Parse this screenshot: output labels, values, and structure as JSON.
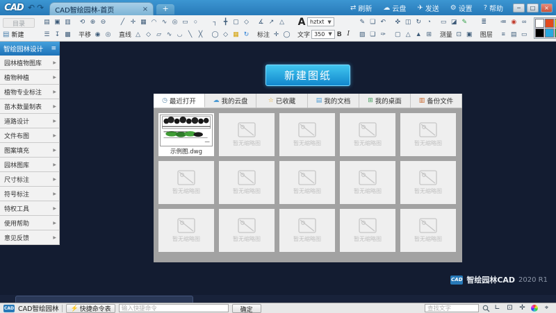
{
  "titlebar": {
    "logo": "CAD",
    "back_icon": "↶",
    "forward_icon": "↷",
    "tab_title": "CAD智绘园林-首页",
    "tab_close": "×",
    "new_tab": "+",
    "actions": [
      {
        "n": "refresh-icon",
        "g": "⇄",
        "label": "刷新"
      },
      {
        "n": "cloud-icon",
        "g": "☁",
        "label": "云盘"
      },
      {
        "n": "send-icon",
        "g": "✈",
        "label": "发送"
      },
      {
        "n": "settings-icon",
        "g": "⚙",
        "label": "设置"
      },
      {
        "n": "help-icon",
        "g": "?",
        "label": "帮助"
      }
    ],
    "window_controls": [
      {
        "n": "minimize-icon",
        "g": "─"
      },
      {
        "n": "maximize-icon",
        "g": "□"
      },
      {
        "n": "close-icon",
        "g": "×",
        "close": "close"
      }
    ]
  },
  "toolbar": {
    "catalog": "目录",
    "new": "新建",
    "new_icon": "▤",
    "pan_label": "平移",
    "line_label": "直线",
    "dim_label": "标注",
    "text_big": "A",
    "text_label": "文字",
    "font": "hztxt",
    "size": "350",
    "bold": "B",
    "italic": "I",
    "measure_label": "测量",
    "layer_label": "图层",
    "g2r1": [
      {
        "n": "open-icon",
        "g": "▤"
      },
      {
        "n": "save-icon",
        "g": "▣"
      },
      {
        "n": "save-as-icon",
        "g": "▥"
      }
    ],
    "g2r2": [
      {
        "n": "print-icon",
        "g": "☰"
      },
      {
        "n": "export-icon",
        "g": "↧"
      },
      {
        "n": "image-export-icon",
        "g": "▩"
      }
    ],
    "g3r1": [
      {
        "n": "orbit-icon",
        "g": "⟲"
      },
      {
        "n": "zoom-in-icon",
        "g": "⊕"
      },
      {
        "n": "zoom-out-icon",
        "g": "⊖"
      }
    ],
    "g3r2": [
      {
        "n": "zoom-realtime-icon",
        "g": "◉"
      },
      {
        "n": "zoom-extents-icon",
        "g": "◎"
      }
    ],
    "g4r1": [
      {
        "n": "line-icon",
        "g": "╱"
      },
      {
        "n": "point-icon",
        "g": "✛"
      },
      {
        "n": "array-icon",
        "g": "▦"
      },
      {
        "n": "arc-icon",
        "g": "◠"
      },
      {
        "n": "spline-icon",
        "g": "∿"
      },
      {
        "n": "circle-icon",
        "g": "◎"
      },
      {
        "n": "rectangle-icon",
        "g": "▭"
      },
      {
        "n": "ellipse-icon",
        "g": "○"
      }
    ],
    "g4r2": [
      {
        "n": "triangle-icon",
        "g": "△"
      },
      {
        "n": "polygon-icon",
        "g": "◇"
      },
      {
        "n": "parallelogram-icon",
        "g": "▱"
      },
      {
        "n": "wave-icon",
        "g": "∿"
      },
      {
        "n": "halfcircle-icon",
        "g": "◡"
      },
      {
        "n": "segment-icon",
        "g": "╲"
      },
      {
        "n": "crossline-icon",
        "g": "╳"
      }
    ],
    "g5r1": [
      {
        "n": "chamfer-icon",
        "g": "┐"
      },
      {
        "n": "extend-icon",
        "g": "╋"
      },
      {
        "n": "round-rect-icon",
        "g": "▢"
      },
      {
        "n": "poly2-icon",
        "g": "◇"
      }
    ],
    "g5r2": [
      {
        "n": "circle2-icon",
        "g": "◯"
      },
      {
        "n": "hexagon-icon",
        "g": "◇"
      },
      {
        "n": "grid-icon",
        "g": "▦",
        "css": "color:#d4a106"
      },
      {
        "n": "sync-icon",
        "g": "↻",
        "css": "color:#2a7fd4"
      }
    ],
    "g6r1": [
      {
        "n": "angular-dim-icon",
        "g": "∡"
      },
      {
        "n": "leader-icon",
        "g": "↗"
      },
      {
        "n": "tolerance-icon",
        "g": "△"
      }
    ],
    "g6r2": [
      {
        "n": "center-mark-icon",
        "g": "✛"
      },
      {
        "n": "diameter-dim-icon",
        "g": "◯"
      }
    ],
    "g8r1": [
      {
        "n": "sketch-icon",
        "g": "✎"
      },
      {
        "n": "copy-icon",
        "g": "❏"
      },
      {
        "n": "undo-icon",
        "g": "↶"
      }
    ],
    "g8r2": [
      {
        "n": "erase-icon",
        "g": "▨"
      },
      {
        "n": "paste-icon",
        "g": "❏"
      },
      {
        "n": "brush-icon",
        "g": "✑"
      }
    ],
    "g9r1": [
      {
        "n": "move-icon",
        "g": "✜"
      },
      {
        "n": "window-icon",
        "g": "◫"
      },
      {
        "n": "rotate-icon",
        "g": "↻"
      },
      {
        "n": "orbit3d-icon",
        "g": "◔"
      }
    ],
    "g9r2": [
      {
        "n": "rect-dash-icon",
        "g": "▢"
      },
      {
        "n": "pyramid-icon",
        "g": "△"
      },
      {
        "n": "cone-icon",
        "g": "▲"
      },
      {
        "n": "viewport-grid-icon",
        "g": "⊞"
      }
    ],
    "g10r1": [
      {
        "n": "ruler-icon",
        "g": "▭"
      },
      {
        "n": "area-chart-icon",
        "g": "◪"
      },
      {
        "n": "pencil-icon",
        "g": "✎",
        "css": "color:#2f9e44"
      }
    ],
    "g10r2": [
      {
        "n": "screen-icon",
        "g": "⊡"
      },
      {
        "n": "monitor-icon",
        "g": "▣"
      }
    ],
    "g11r1": [
      {
        "n": "layers-icon",
        "g": "≣"
      }
    ],
    "g12r1": [
      {
        "n": "linetype-icon",
        "g": "≔"
      },
      {
        "n": "color-pie-icon",
        "g": "◉",
        "css": "color:#c0392b"
      },
      {
        "n": "link-icon",
        "g": "∞"
      }
    ],
    "g12r2": [
      {
        "n": "lineweight-icon",
        "g": "≡"
      },
      {
        "n": "table-icon",
        "g": "▤"
      },
      {
        "n": "plot-icon",
        "g": "▭"
      }
    ],
    "palette": [
      {
        "n": "swatch-white",
        "css": "background:#ffffff"
      },
      {
        "n": "swatch-red",
        "css": "background:#e2491d"
      },
      {
        "n": "swatch-yellow",
        "css": "background:#f0f000"
      },
      {
        "n": "swatch-yellowgreen",
        "css": "background:#86d542"
      },
      {
        "n": "swatch-black",
        "css": "background:#000000"
      },
      {
        "n": "swatch-blue",
        "css": "background:#28a8e0"
      },
      {
        "n": "swatch-green",
        "css": "background:#22b14c"
      },
      {
        "n": "swatch-purple",
        "css": "background:#8146c8"
      }
    ]
  },
  "sidebar": {
    "header": "智绘园林设计",
    "menu_icon": "≡",
    "items": [
      "园林植物图库",
      "植物种植",
      "植物专业标注",
      "苗木数量制表",
      "道路设计",
      "文件布图",
      "图案填充",
      "园林图库",
      "尺寸标注",
      "符号标注",
      "特权工具",
      "使用帮助",
      "意见反馈"
    ]
  },
  "main": {
    "new_drawing_button": "新建图纸",
    "tabs": [
      {
        "label": "最近打开",
        "icon_name": "clock-icon",
        "icon_glyph": "◷",
        "icon_css": "color:#5b87a8",
        "active": true
      },
      {
        "label": "我的云盘",
        "icon_name": "cloud-icon",
        "icon_glyph": "☁",
        "icon_css": "color:#4a9ad4"
      },
      {
        "label": "已收藏",
        "icon_name": "star-icon",
        "icon_glyph": "☆",
        "icon_css": "color:#e8a71c"
      },
      {
        "label": "我的文档",
        "icon_name": "document-icon",
        "icon_glyph": "▤",
        "icon_css": "color:#4a9ad4"
      },
      {
        "label": "我的桌面",
        "icon_name": "desktop-icon",
        "icon_glyph": "⊞",
        "icon_css": "color:#44a05e"
      },
      {
        "label": "备份文件",
        "icon_name": "backup-icon",
        "icon_glyph": "▥",
        "icon_css": "color:#c86428"
      }
    ],
    "file": {
      "name": "示例图.dwg"
    },
    "placeholders": [
      "暂无缩略图",
      "暂无缩略图",
      "暂无缩略图",
      "暂无缩略图",
      "暂无缩略图",
      "暂无缩略图",
      "暂无缩略图",
      "暂无缩略图",
      "暂无缩略图",
      "暂无缩略图",
      "暂无缩略图",
      "暂无缩略图",
      "暂无缩略图",
      "暂无缩略图"
    ]
  },
  "brand": {
    "logo": "CAD",
    "name": "智绘园林CAD",
    "version": "2020 R1"
  },
  "statusbar": {
    "logo": "CAD",
    "app_tab": "CAD智绘园林",
    "quick_icon": "⚡",
    "quick_button": "快捷命令表",
    "cmd_placeholder": "输入快捷命令",
    "confirm_button": "确定",
    "search_placeholder": "查找文字",
    "icons": [
      {
        "n": "ucs-axis-icon",
        "g": "∟"
      },
      {
        "n": "viewport-icon",
        "g": "⊡"
      },
      {
        "n": "crosshair-icon",
        "g": "✛"
      },
      {
        "n": "colorwheel-icon",
        "g": "●",
        "css": "color:transparent;background:conic-gradient(#e33,#ee3,#3c3,#3cc,#33e,#e3e,#e33);border-radius:50%;width:10px;height:10px"
      },
      {
        "n": "cursor-icon",
        "g": "⌖"
      }
    ]
  }
}
